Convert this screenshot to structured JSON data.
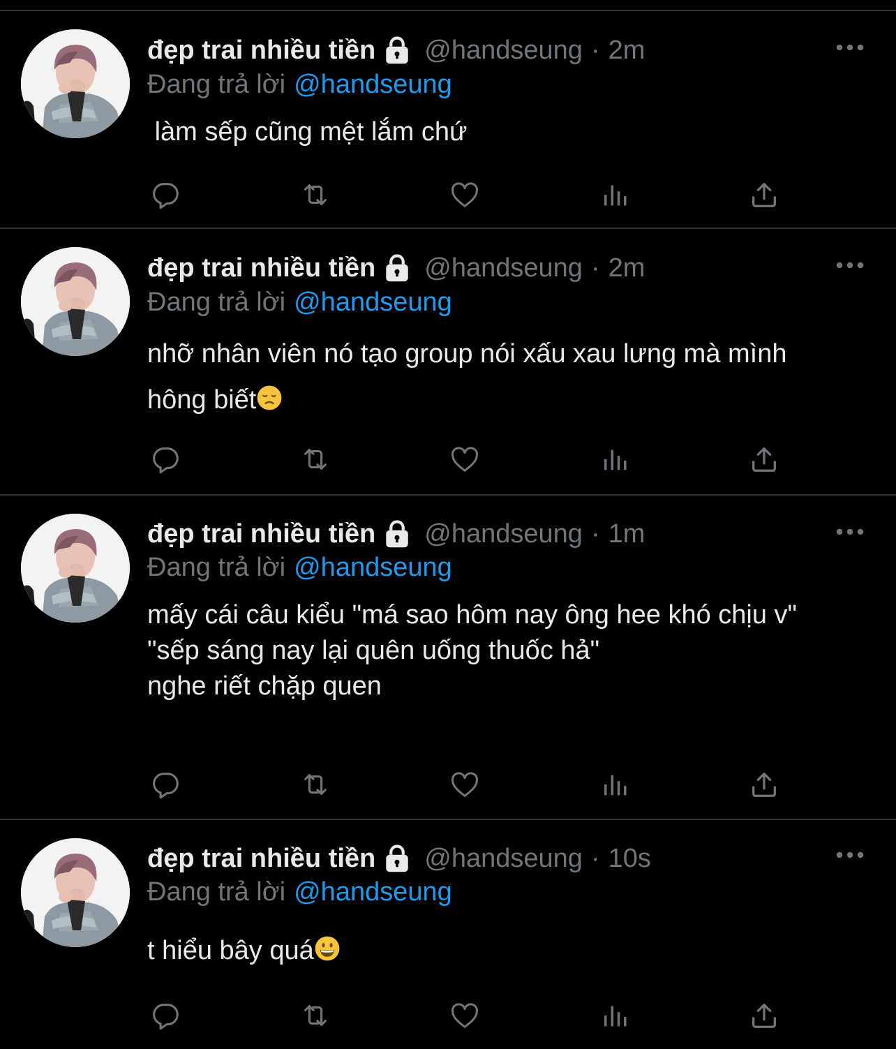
{
  "colors": {
    "background": "#000000",
    "divider": "#2f3336",
    "text_primary": "#e7e9ea",
    "text_secondary": "#71767b",
    "accent": "#1d9bf0"
  },
  "tweets": [
    {
      "display_name": "đẹp trai nhiều tiền",
      "handle": "@handseung",
      "separator": "·",
      "time": "2m",
      "reply_prefix": "Đang trả lời",
      "reply_handle": "@handseung",
      "text": " làm sếp cũng mệt lắm chứ",
      "emoji": ""
    },
    {
      "display_name": "đẹp trai nhiều tiền",
      "handle": "@handseung",
      "separator": "·",
      "time": "2m",
      "reply_prefix": "Đang trả lời",
      "reply_handle": "@handseung",
      "text": "nhỡ nhân viên nó tạo group nói xấu xau lưng mà mình hông biết",
      "emoji": "disappointed-face-emoji"
    },
    {
      "display_name": "đẹp trai nhiều tiền",
      "handle": "@handseung",
      "separator": "·",
      "time": "1m",
      "reply_prefix": "Đang trả lời",
      "reply_handle": "@handseung",
      "text": "mấy cái câu kiểu \"má sao hôm nay ông hee khó chịu v\"\n\"sếp sáng nay lại quên uống thuốc hả\"\nnghe riết chặp quen",
      "emoji": ""
    },
    {
      "display_name": "đẹp trai nhiều tiền",
      "handle": "@handseung",
      "separator": "·",
      "time": "10s",
      "reply_prefix": "Đang trả lời",
      "reply_handle": "@handseung",
      "text": "t hiểu bây quá",
      "emoji": "grinning-face-emoji"
    }
  ],
  "actions": [
    "reply-icon",
    "retweet-icon",
    "like-icon",
    "analytics-icon",
    "share-icon"
  ]
}
